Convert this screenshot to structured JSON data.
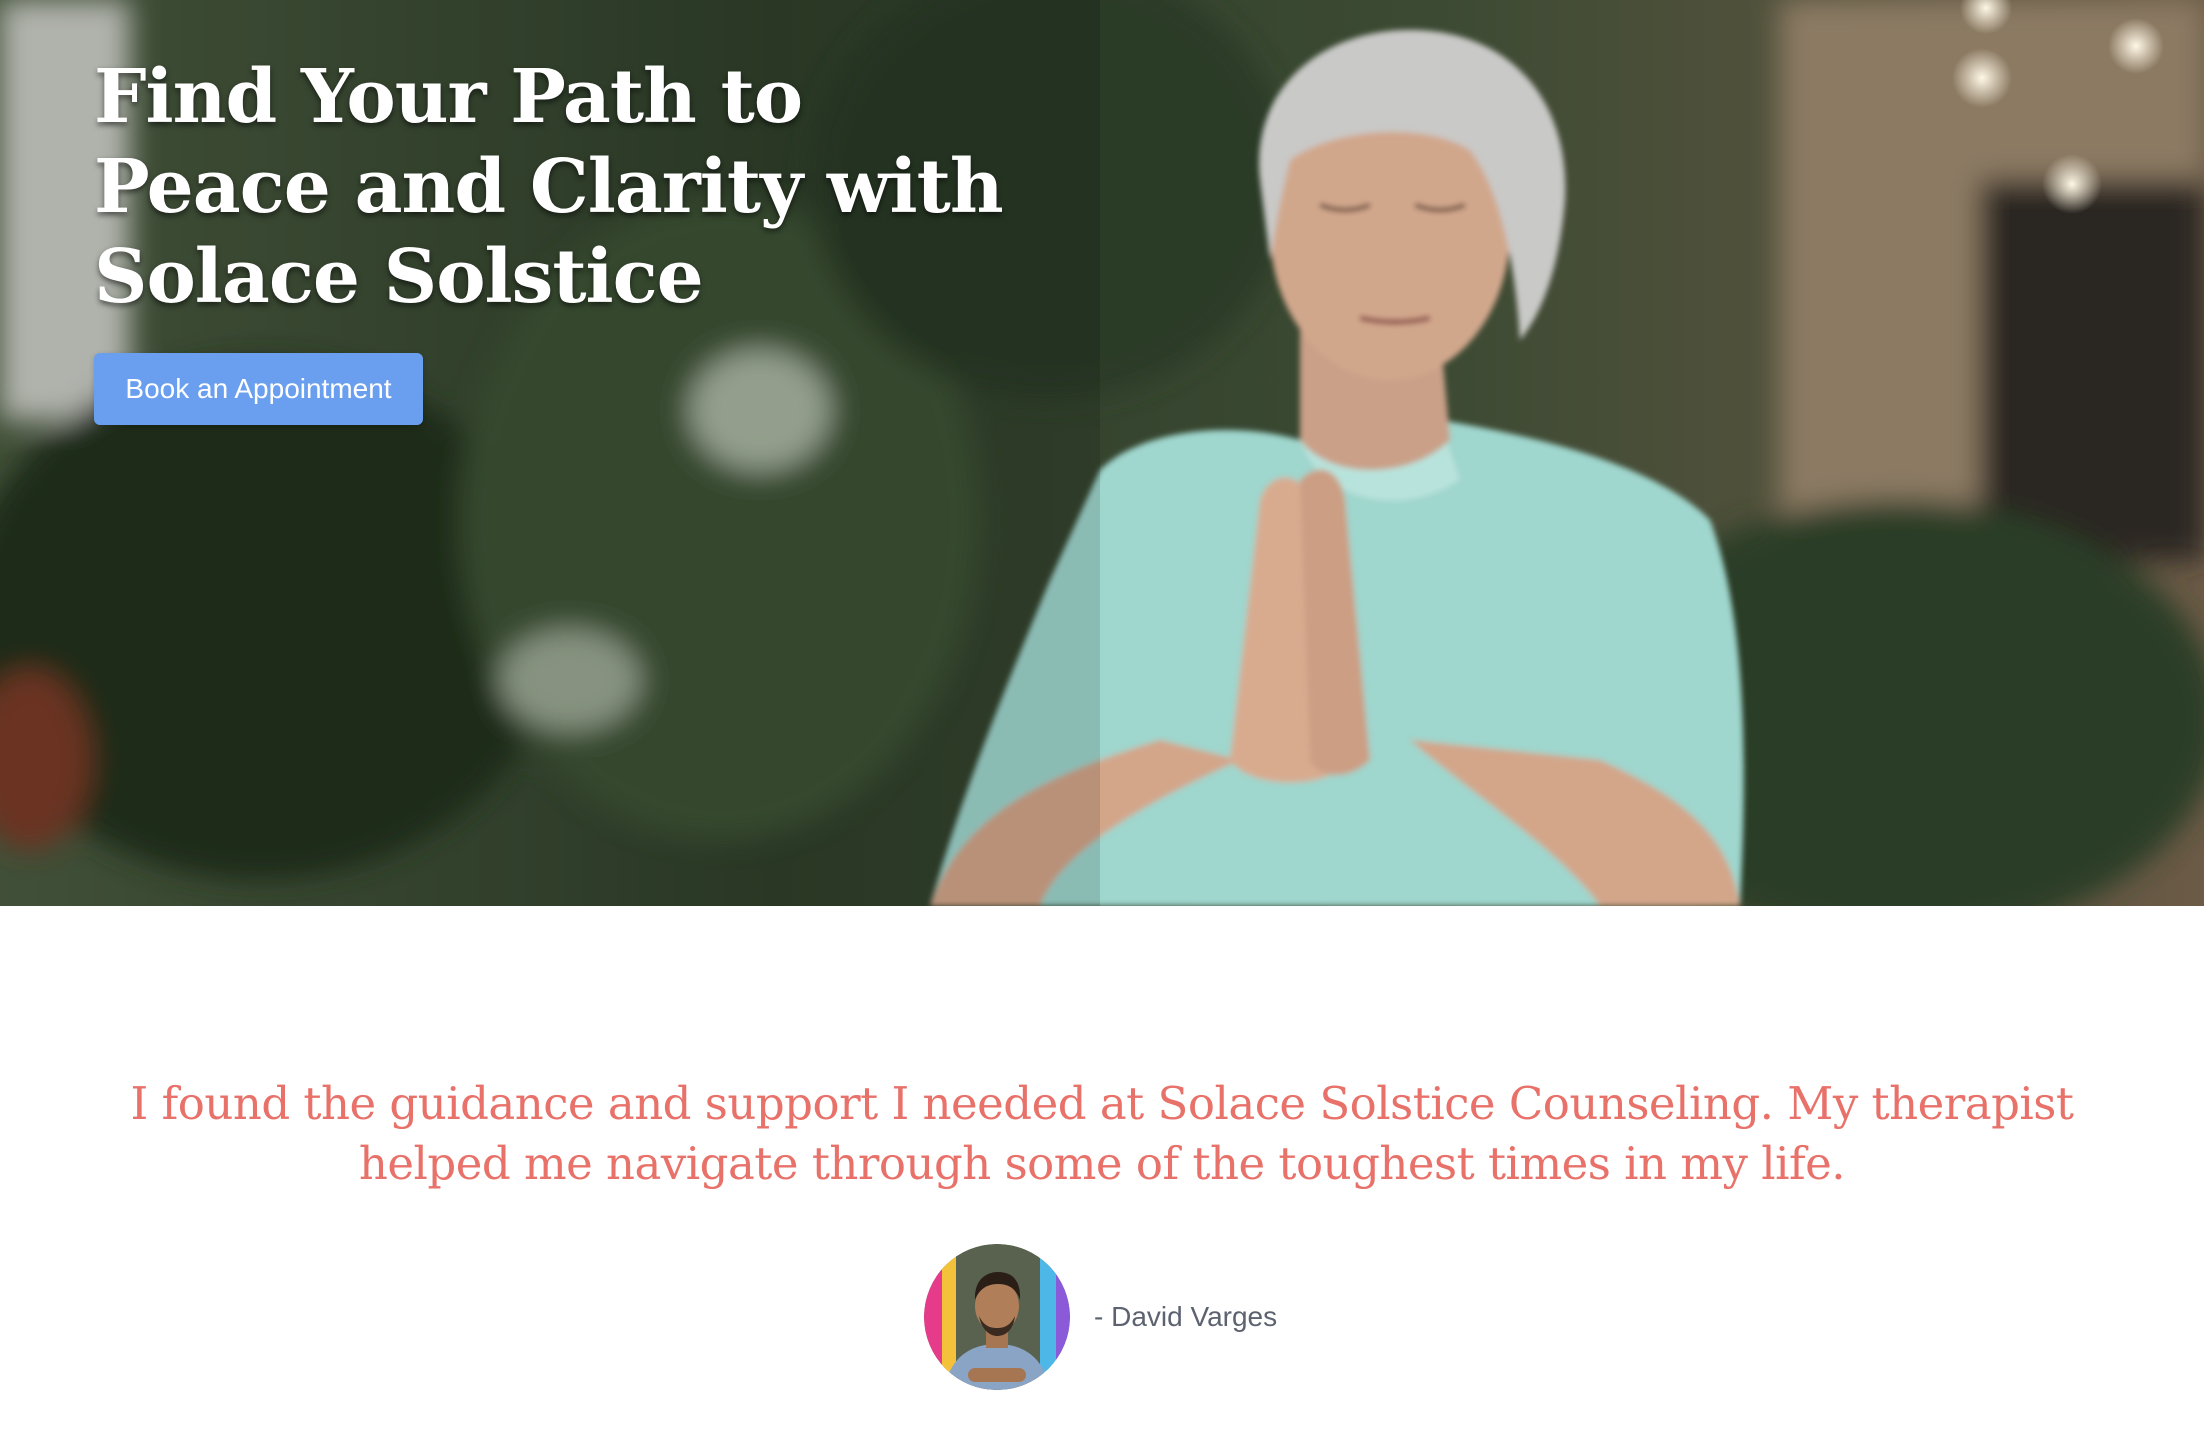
{
  "hero": {
    "title": "Find Your Path to Peace and Clarity with Solace Solstice",
    "cta_label": "Book an Appointment",
    "cta_color": "#6a9ff0"
  },
  "testimonial": {
    "quote": "I found the guidance and support I needed at Solace Solstice Counseling. My therapist helped me navigate through some of the toughest times in my life.",
    "author": "- David Varges",
    "quote_color": "#e8716a"
  }
}
